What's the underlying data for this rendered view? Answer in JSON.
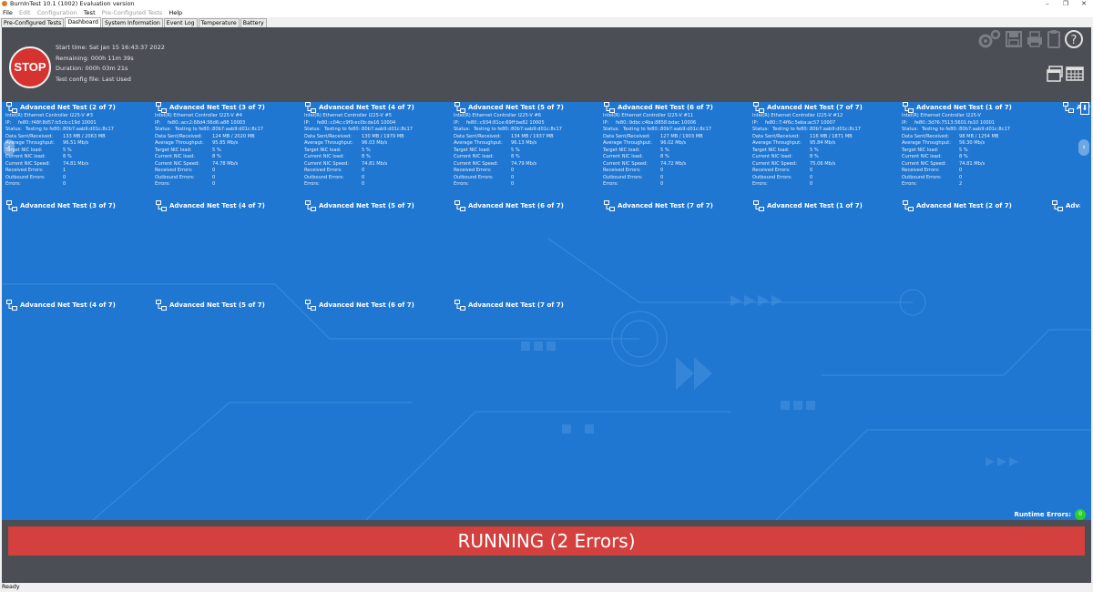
{
  "window": {
    "title": "BurnInTest 10.1 (1002) Evaluation version",
    "minimize": "–",
    "restore": "❐",
    "close": "✕"
  },
  "menu": [
    "File",
    "Edit",
    "Configuration",
    "Test",
    "Pre-Configured Tests",
    "Help"
  ],
  "tabs": [
    "Pre-Configured Tests",
    "Dashboard",
    "System Information",
    "Event Log",
    "Temperature",
    "Battery"
  ],
  "stop_label": "STOP",
  "test_info": {
    "start": "Start time: Sat Jan 15 16:43:37 2022",
    "remaining": "Remaining: 000h 11m 39s",
    "duration": "Duration: 000h 03m 21s",
    "config": "Test config file: Last Used"
  },
  "toolbar_icons": [
    "settings-gears-icon",
    "save-icon",
    "print-icon",
    "clipboard-icon",
    "help-icon"
  ],
  "view_icons": [
    "window-view-icon",
    "table-view-icon"
  ],
  "labels": {
    "ip": "IP:",
    "status": "Status:",
    "sent": "Data Sent/Received:",
    "avg": "Average Throughput:",
    "target": "Target NIC load:",
    "current": "Current NIC load:",
    "speed": "Current NIC Speed:",
    "recv_err": "Received Errors:",
    "out_err": "Outbound Errors:",
    "errors": "Errors:"
  },
  "row1": [
    {
      "title": "Advanced Net Test (2 of 7)",
      "nic": "Intel(R) Ethernet Controller I225-V #3",
      "ip": "fe80::f48f:8d57:b5cb:c19d 10001",
      "status": "Testing to fe80::80b7:aab9:d01c:8c17",
      "sent": "133 MB / 2063 MB",
      "avg": "96.51 Mb/s",
      "target": "5 %",
      "current": "8 %",
      "speed": "74.81 Mb/s",
      "recv_err": "1",
      "out_err": "0",
      "errors": "0"
    },
    {
      "title": "Advanced Net Test (3 of 7)",
      "nic": "Intel(R) Ethernet Controller I225-V #4",
      "ip": "fe80::acc2:68d4:56d6:a88 10003",
      "status": "Testing to fe80::80b7:aab9:d01c:8c17",
      "sent": "124 MB / 2020 MB",
      "avg": "95.85 Mb/s",
      "target": "5 %",
      "current": "8 %",
      "speed": "74.78 Mb/s",
      "recv_err": "0",
      "out_err": "0",
      "errors": "0"
    },
    {
      "title": "Advanced Net Test (4 of 7)",
      "nic": "Intel(R) Ethernet Controller I225-V #5",
      "ip": "fe80::c04c:c9f9:ec0b:de16 10004",
      "status": "Testing to fe80::80b7:aab9:d01c:8c17",
      "sent": "130 MB / 1979 MB",
      "avg": "96.03 Mb/s",
      "target": "5 %",
      "current": "8 %",
      "speed": "74.81 Mb/s",
      "recv_err": "0",
      "out_err": "0",
      "errors": "0"
    },
    {
      "title": "Advanced Net Test (5 of 7)",
      "nic": "Intel(R) Ethernet Controller I225-V #6",
      "ip": "fe80::c934:81ce:69ff:be82 10005",
      "status": "Testing to fe80::80b7:aab9:d01c:8c17",
      "sent": "134 MB / 1937 MB",
      "avg": "96.13 Mb/s",
      "target": "5 %",
      "current": "8 %",
      "speed": "74.79 Mb/s",
      "recv_err": "0",
      "out_err": "0",
      "errors": "0"
    },
    {
      "title": "Advanced Net Test (6 of 7)",
      "nic": "Intel(R) Ethernet Controller I225-V #11",
      "ip": "fe80::9dbc:c4ba:8858:bdac 10006",
      "status": "Testing to fe80::80b7:aab9:d01c:8c17",
      "sent": "127 MB / 1903 MB",
      "avg": "96.02 Mb/s",
      "target": "5 %",
      "current": "8 %",
      "speed": "74.72 Mb/s",
      "recv_err": "0",
      "out_err": "0",
      "errors": "0"
    },
    {
      "title": "Advanced Net Test (7 of 7)",
      "nic": "Intel(R) Ethernet Controller I225-V #12",
      "ip": "fe80::7:4f6c:5eba:ac57 10007",
      "status": "Testing to fe80::80b7:aab9:d01c:8c17",
      "sent": "116 MB / 1871 MB",
      "avg": "95.84 Mb/s",
      "target": "5 %",
      "current": "8 %",
      "speed": "75.06 Mb/s",
      "recv_err": "0",
      "out_err": "0",
      "errors": "0"
    },
    {
      "title": "Advanced Net Test (1 of 7)",
      "nic": "Intel(R) Ethernet Controller I225-V",
      "ip": "fe80::3d76:7513:5601:fe10 10001",
      "status": "Testing to fe80::80b7:aab9:d01c:8c17",
      "sent": "98 MB / 1254 MB",
      "avg": "56.30 Mb/s",
      "target": "5 %",
      "current": "8 %",
      "speed": "74.81 Mb/s",
      "recv_err": "0",
      "out_err": "0",
      "errors": "2"
    }
  ],
  "row1_partial": "Adv",
  "row2": [
    "Advanced Net Test (3 of 7)",
    "Advanced Net Test (4 of 7)",
    "Advanced Net Test (5 of 7)",
    "Advanced Net Test (6 of 7)",
    "Advanced Net Test (7 of 7)",
    "Advanced Net Test (1 of 7)",
    "Advanced Net Test (2 of 7)",
    "Advance"
  ],
  "row3": [
    "Advanced Net Test (4 of 7)",
    "Advanced Net Test (5 of 7)",
    "Advanced Net Test (6 of 7)",
    "Advanced Net Test (7 of 7)"
  ],
  "nav": {
    "prev": "‹",
    "next": "›",
    "scroll": "⬇"
  },
  "runtime_errors": {
    "label": "Runtime Errors:",
    "count": "0"
  },
  "running_banner": "RUNNING (2 Errors)",
  "status": "Ready",
  "colors": {
    "dashboard_bg": "#1f77d2",
    "stop": "#d6322f",
    "running": "#d3403d",
    "ok": "#2bd12b"
  }
}
